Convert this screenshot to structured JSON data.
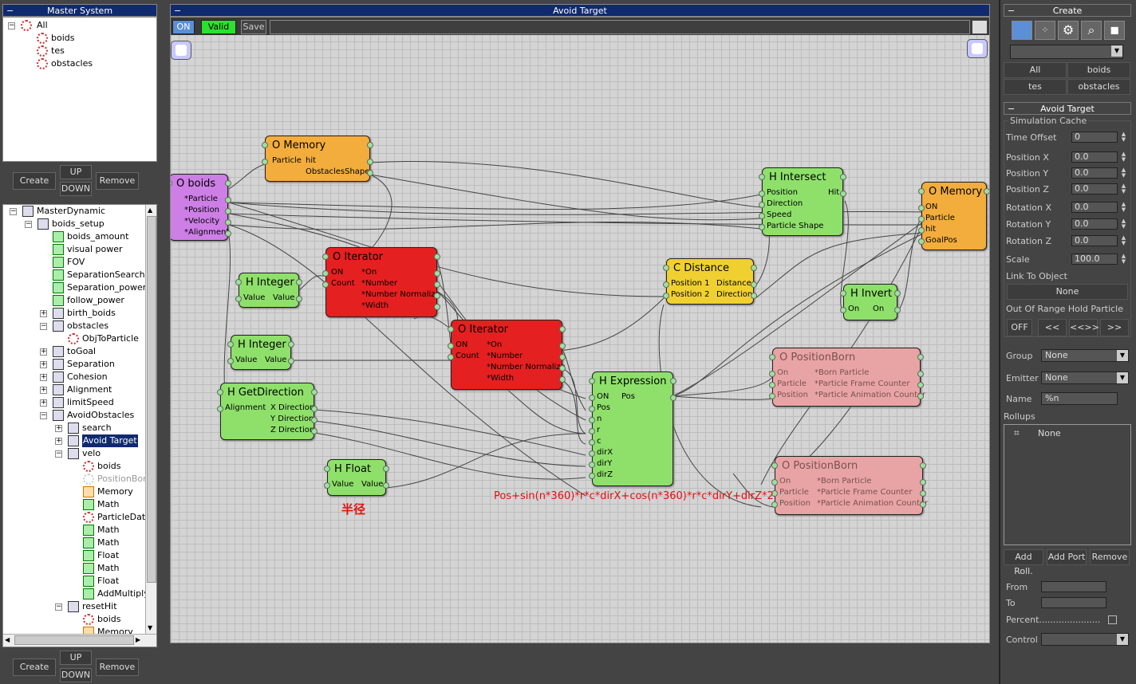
{
  "master_system": {
    "title": "Master System",
    "items": [
      "All",
      "boids",
      "tes",
      "obstacles"
    ]
  },
  "top_buttons": {
    "create": "Create",
    "up": "UP",
    "down": "DOWN",
    "remove": "Remove"
  },
  "master_dynamic": {
    "items": [
      {
        "label": "MasterDynamic",
        "depth": 0,
        "pm": "minus",
        "icon": "doc"
      },
      {
        "label": "boids_setup",
        "depth": 1,
        "pm": "minus",
        "icon": "doc"
      },
      {
        "label": "boids_amount",
        "depth": 2,
        "pm": "",
        "icon": "leaf"
      },
      {
        "label": "visual power",
        "depth": 2,
        "pm": "",
        "icon": "leaf"
      },
      {
        "label": "FOV",
        "depth": 2,
        "pm": "",
        "icon": "leaf"
      },
      {
        "label": "SeparationSearchDis",
        "depth": 2,
        "pm": "",
        "icon": "leaf"
      },
      {
        "label": "Separation_power",
        "depth": 2,
        "pm": "",
        "icon": "leaf"
      },
      {
        "label": "follow_power",
        "depth": 2,
        "pm": "",
        "icon": "leaf"
      },
      {
        "label": "birth_boids",
        "depth": 2,
        "pm": "plus",
        "icon": "doc"
      },
      {
        "label": "obstacles",
        "depth": 2,
        "pm": "minus",
        "icon": "doc"
      },
      {
        "label": "ObjToParticle",
        "depth": 3,
        "pm": "",
        "icon": "gear"
      },
      {
        "label": "toGoal",
        "depth": 2,
        "pm": "plus",
        "icon": "doc"
      },
      {
        "label": "Separation",
        "depth": 2,
        "pm": "plus",
        "icon": "doc"
      },
      {
        "label": "Cohesion",
        "depth": 2,
        "pm": "plus",
        "icon": "doc"
      },
      {
        "label": "Alignment",
        "depth": 2,
        "pm": "plus",
        "icon": "doc"
      },
      {
        "label": "limitSpeed",
        "depth": 2,
        "pm": "plus",
        "icon": "doc"
      },
      {
        "label": "AvoidObstacles",
        "depth": 2,
        "pm": "minus",
        "icon": "doc"
      },
      {
        "label": "search",
        "depth": 3,
        "pm": "plus",
        "icon": "doc"
      },
      {
        "label": "Avoid Target",
        "depth": 3,
        "pm": "plus",
        "icon": "doc",
        "selected": true
      },
      {
        "label": "velo",
        "depth": 3,
        "pm": "minus",
        "icon": "doc"
      },
      {
        "label": "boids",
        "depth": 4,
        "pm": "",
        "icon": "gear"
      },
      {
        "label": "PositionBorn",
        "depth": 4,
        "pm": "",
        "icon": "gear-gray"
      },
      {
        "label": "Memory",
        "depth": 4,
        "pm": "",
        "icon": "leaf-org"
      },
      {
        "label": "Math",
        "depth": 4,
        "pm": "",
        "icon": "leaf"
      },
      {
        "label": "ParticleData",
        "depth": 4,
        "pm": "",
        "icon": "gear"
      },
      {
        "label": "Math",
        "depth": 4,
        "pm": "",
        "icon": "leaf"
      },
      {
        "label": "Math",
        "depth": 4,
        "pm": "",
        "icon": "leaf"
      },
      {
        "label": "Float",
        "depth": 4,
        "pm": "",
        "icon": "leaf"
      },
      {
        "label": "Math",
        "depth": 4,
        "pm": "",
        "icon": "leaf"
      },
      {
        "label": "Float",
        "depth": 4,
        "pm": "",
        "icon": "leaf"
      },
      {
        "label": "AddMultiply",
        "depth": 4,
        "pm": "",
        "icon": "leaf"
      },
      {
        "label": "resetHit",
        "depth": 3,
        "pm": "minus",
        "icon": "doc"
      },
      {
        "label": "boids",
        "depth": 4,
        "pm": "",
        "icon": "gear"
      },
      {
        "label": "Memory",
        "depth": 4,
        "pm": "",
        "icon": "leaf-org"
      }
    ]
  },
  "bottom_buttons": {
    "create": "Create",
    "up": "UP",
    "down": "DOWN",
    "remove": "Remove"
  },
  "editor": {
    "title": "Avoid Target",
    "on": "ON",
    "valid": "Valid",
    "save": "Save"
  },
  "nodes": {
    "memory1": {
      "title": "O Memory",
      "left": [
        "Particle"
      ],
      "right": [
        "hit",
        "ObstaclesShape"
      ]
    },
    "boids": {
      "title": "O boids",
      "left": [],
      "right": [
        "*Particle",
        "*Position",
        "*Velocity",
        "*Alignment"
      ]
    },
    "iter1": {
      "title": "O Iterator",
      "left": [
        "ON",
        "Count"
      ],
      "right": [
        "*On",
        "*Number",
        "*Number Normalize",
        "*Width"
      ]
    },
    "hint1": {
      "title": "H Integer",
      "left": [
        "Value"
      ],
      "right": [
        "Value"
      ]
    },
    "iter2": {
      "title": "O Iterator",
      "left": [
        "ON",
        "Count"
      ],
      "right": [
        "*On",
        "*Number",
        "*Number Normalize",
        "*Width"
      ]
    },
    "hint2": {
      "title": "H Integer",
      "left": [
        "Value"
      ],
      "right": [
        "Value"
      ]
    },
    "getdir": {
      "title": "H GetDirection",
      "left": [
        "Alignment"
      ],
      "right": [
        "X Direction",
        "Y Direction",
        "Z Direction"
      ]
    },
    "hfloat": {
      "title": "H Float",
      "left": [
        "Value"
      ],
      "right": [
        "Value"
      ]
    },
    "expr": {
      "title": "H Expression",
      "left": [
        "ON",
        "Pos",
        "n",
        "r",
        "c",
        "dirX",
        "dirY",
        "dirZ"
      ],
      "right": [
        "Pos"
      ]
    },
    "cdist": {
      "title": "C Distance",
      "left": [
        "Position 1",
        "Position 2"
      ],
      "right": [
        "Distance",
        "Direction"
      ]
    },
    "intersect": {
      "title": "H Intersect",
      "left": [
        "Position",
        "Direction",
        "Speed",
        "Particle Shape"
      ],
      "right": [
        "Hit"
      ]
    },
    "invert": {
      "title": "H Invert",
      "left": [
        "On"
      ],
      "right": [
        "On"
      ]
    },
    "memory2": {
      "title": "O Memory",
      "left": [
        "ON",
        "Particle",
        "hit",
        "GoalPos"
      ],
      "right": []
    },
    "pborn1": {
      "title": "O PositionBorn",
      "left": [
        "On",
        "Particle",
        "Position"
      ],
      "right": [
        "*Born Particle",
        "*Particle Frame Counter",
        "*Particle Animation Counter"
      ]
    },
    "pborn2": {
      "title": "O PositionBorn",
      "left": [
        "On",
        "Particle",
        "Position"
      ],
      "right": [
        "*Born Particle",
        "*Particle Frame Counter",
        "*Particle Animation Counter"
      ]
    }
  },
  "annotations": {
    "expression": "Pos+sin(n*360)*r*c*dirX+cos(n*360)*r*c*dirY+dirZ*2",
    "radius": "半径"
  },
  "right_panel": {
    "create_title": "Create",
    "filter_buttons": [
      "All",
      "boids",
      "tes",
      "obstacles"
    ],
    "avoid_title": "Avoid Target",
    "sim_cache": "Simulation Cache",
    "params": [
      {
        "label": "Time Offset",
        "value": "0"
      },
      {
        "label": "Position X",
        "value": "0.0"
      },
      {
        "label": "Position Y",
        "value": "0.0"
      },
      {
        "label": "Position Z",
        "value": "0.0"
      },
      {
        "label": "Rotation X",
        "value": "0.0"
      },
      {
        "label": "Rotation Y",
        "value": "0.0"
      },
      {
        "label": "Rotation Z",
        "value": "0.0"
      },
      {
        "label": "Scale",
        "value": "100.0"
      }
    ],
    "link_to_object": "Link To Object",
    "link_value": "None",
    "out_of_range": "Out Of Range Hold Particle",
    "range_buttons": [
      "OFF",
      "<<",
      "<<>>",
      ">>"
    ],
    "group_label": "Group",
    "group_value": "None",
    "emitter_label": "Emitter",
    "emitter_value": "None",
    "name_label": "Name",
    "name_value": "%n",
    "rollups_label": "Rollups",
    "rollups_item": "None",
    "add_roll": "Add Roll.",
    "add_port": "Add Port",
    "remove": "Remove",
    "from": "From",
    "to": "To",
    "percent": "Percent......................",
    "control": "Control"
  }
}
